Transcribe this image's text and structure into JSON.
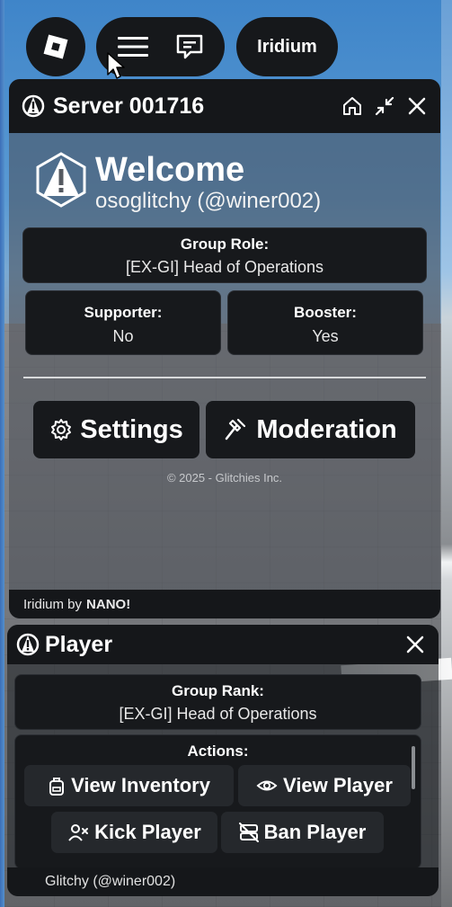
{
  "top_bar": {
    "roblox_icon": "roblox-logo-icon",
    "menu_icon": "hamburger-menu-icon",
    "chat_icon": "chat-icon",
    "iridium_label": "Iridium"
  },
  "server_panel": {
    "title": "Server 001716",
    "welcome_title": "Welcome",
    "username": "osoglitchy (@winer002)",
    "group_role_label": "Group Role:",
    "group_role_value": "[EX-GI] Head of Operations",
    "supporter_label": "Supporter:",
    "supporter_value": "No",
    "booster_label": "Booster:",
    "booster_value": "Yes",
    "settings_label": "Settings",
    "moderation_label": "Moderation",
    "copyright": "© 2025 - Glitchies Inc.",
    "footer_prefix": "Iridium by",
    "footer_brand": "NANO!"
  },
  "player_panel": {
    "title": "Player",
    "group_rank_label": "Group Rank:",
    "group_rank_value": "[EX-GI] Head of Operations",
    "actions_title": "Actions:",
    "view_inventory_label": "View Inventory",
    "view_player_label": "View Player",
    "kick_player_label": "Kick Player",
    "ban_player_label": "Ban Player",
    "footer_user": "Glitchy (@winer002)"
  },
  "colors": {
    "panel_dark": "#15171a",
    "card_dark": "#17191c",
    "text_white": "#ffffff"
  }
}
